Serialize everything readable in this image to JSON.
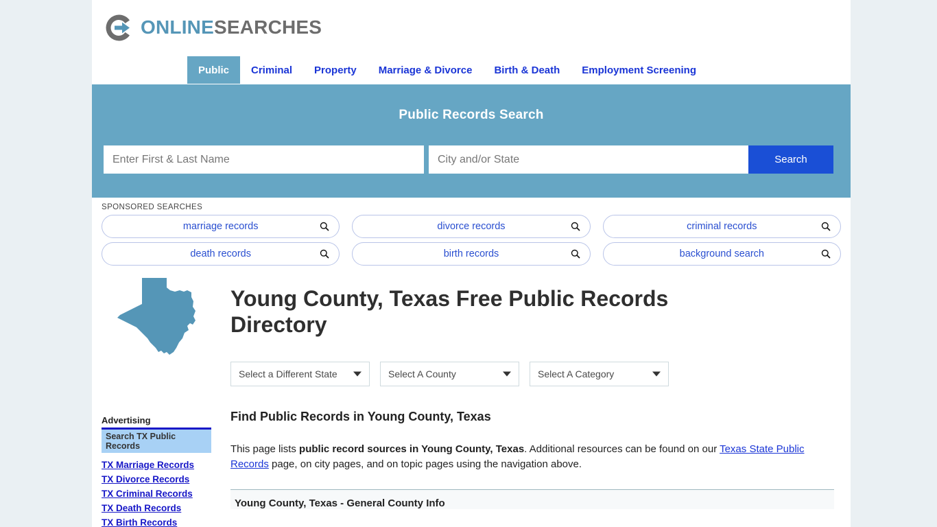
{
  "brand": {
    "logo_word_1": "ONLINE",
    "logo_word_2": "SEARCHES",
    "accent_blue": "#5596b7",
    "accent_gray": "#6d6d6d"
  },
  "nav": {
    "items": [
      {
        "label": "Public",
        "active": true
      },
      {
        "label": "Criminal",
        "active": false
      },
      {
        "label": "Property",
        "active": false
      },
      {
        "label": "Marriage & Divorce",
        "active": false
      },
      {
        "label": "Birth & Death",
        "active": false
      },
      {
        "label": "Employment Screening",
        "active": false
      }
    ]
  },
  "hero": {
    "title": "Public Records Search",
    "name_placeholder": "Enter First & Last Name",
    "name_value": "",
    "location_placeholder": "City and/or State",
    "location_value": "",
    "search_button": "Search",
    "background_color": "#66a6c4",
    "button_color": "#1a4fd6"
  },
  "sponsored": {
    "label": "SPONSORED SEARCHES",
    "pills": [
      "marriage records",
      "divorce records",
      "criminal records",
      "death records",
      "birth records",
      "background search"
    ]
  },
  "sidebar": {
    "state_shape": "texas-state-shape",
    "state_shape_color": "#5596b7",
    "advertising_label": "Advertising",
    "ad_headline": "Search TX Public Records",
    "ad_links": [
      "TX Marriage Records",
      "TX Divorce Records",
      "TX Criminal Records",
      "TX Death Records",
      "TX Birth Records"
    ]
  },
  "main": {
    "page_title": "Young County, Texas Free Public Records Directory",
    "selects": {
      "state": "Select a Different State",
      "county": "Select A County",
      "category": "Select A Category"
    },
    "section_heading": "Find Public Records in Young County, Texas",
    "paragraph": {
      "part1": "This page lists ",
      "bold1": "public record sources in Young County, Texas",
      "part2": ". Additional resources can be found on our ",
      "link": "Texas State Public Records",
      "part3": " page, on city pages, and on topic pages using the navigation above."
    },
    "table_heading": "Young County, Texas - General County Info"
  }
}
